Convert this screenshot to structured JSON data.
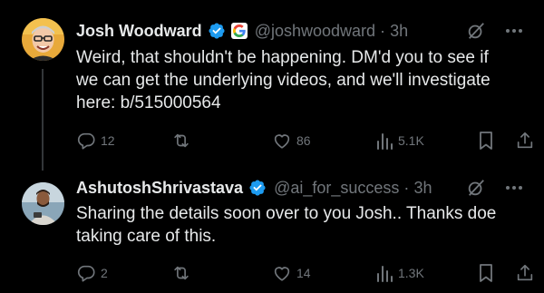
{
  "colors": {
    "background": "#000000",
    "text_primary": "#e7e9ea",
    "text_secondary": "#71767b",
    "verified_blue": "#1d9bf0",
    "thread_line": "#333639"
  },
  "tweets": [
    {
      "display_name": "Josh Woodward",
      "handle": "@joshwoodward",
      "time": "3h",
      "verified": true,
      "affiliate_badge": "google-g-icon",
      "text": "Weird, that shouldn't be happening. DM'd you to see if\nwe can get the underlying videos, and we'll investigate\nhere: b/515000564",
      "metrics": {
        "replies": "12",
        "reposts": "",
        "likes": "86",
        "views": "5.1K"
      }
    },
    {
      "display_name": "AshutoshShrivastava",
      "handle": "@ai_for_success",
      "time": "3h",
      "verified": true,
      "text": "Sharing the details soon over to you Josh.. Thanks doe\ntaking care of this.",
      "metrics": {
        "replies": "2",
        "reposts": "",
        "likes": "14",
        "views": "1.3K"
      }
    }
  ],
  "separator": "·",
  "icons": {
    "verified": "verified-badge-icon",
    "grok": "grok-icon",
    "more": "more-options-icon",
    "reply": "reply-icon",
    "repost": "repost-icon",
    "like": "heart-icon",
    "views": "analytics-icon",
    "bookmark": "bookmark-icon",
    "share": "share-icon"
  }
}
